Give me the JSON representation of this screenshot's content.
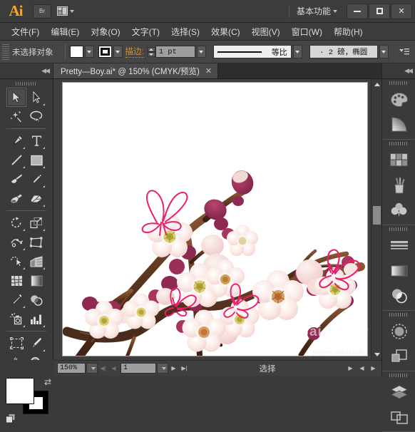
{
  "app": {
    "logo": "Ai",
    "bridge_label": "Br",
    "arrange_label": "arrange-documents",
    "workspace": "基本功能",
    "window_buttons": {
      "minimize": "minimize",
      "maximize": "maximize",
      "close": "✕"
    }
  },
  "menubar": {
    "items": [
      {
        "label": "文件(F)",
        "name": "menu-file"
      },
      {
        "label": "编辑(E)",
        "name": "menu-edit"
      },
      {
        "label": "对象(O)",
        "name": "menu-object"
      },
      {
        "label": "文字(T)",
        "name": "menu-type"
      },
      {
        "label": "选择(S)",
        "name": "menu-select"
      },
      {
        "label": "效果(C)",
        "name": "menu-effect"
      },
      {
        "label": "视图(V)",
        "name": "menu-view"
      },
      {
        "label": "窗口(W)",
        "name": "menu-window"
      },
      {
        "label": "帮助(H)",
        "name": "menu-help"
      }
    ]
  },
  "controlbar": {
    "selection_status": "未选择对象",
    "fill_color": "#ffffff",
    "stroke_color": "#000000",
    "stroke_label": "描边:",
    "stroke_weight": "1 pt",
    "brush_definition": "等比",
    "variable_width_profile": "·  2 磅，椭圆",
    "panel_menu": "panel-menu"
  },
  "document": {
    "tab_title": "Pretty—Boy.ai* @ 150% (CMYK/预览)",
    "close_label": "✕"
  },
  "toolbar": {
    "tools": [
      {
        "name": "selection-tool",
        "label": "选择工具",
        "selected": true,
        "has_flyout": false
      },
      {
        "name": "direct-selection-tool",
        "label": "直接选择工具",
        "selected": false,
        "has_flyout": true
      },
      {
        "name": "magic-wand-tool",
        "label": "魔棒工具",
        "selected": false,
        "has_flyout": false
      },
      {
        "name": "lasso-tool",
        "label": "套索工具",
        "selected": false,
        "has_flyout": false
      },
      {
        "name": "pen-tool",
        "label": "钢笔工具",
        "selected": false,
        "has_flyout": true
      },
      {
        "name": "type-tool",
        "label": "文字工具",
        "selected": false,
        "has_flyout": true
      },
      {
        "name": "line-segment-tool",
        "label": "直线段工具",
        "selected": false,
        "has_flyout": true
      },
      {
        "name": "rectangle-tool",
        "label": "矩形工具",
        "selected": false,
        "has_flyout": true
      },
      {
        "name": "paintbrush-tool",
        "label": "画笔工具",
        "selected": false,
        "has_flyout": false
      },
      {
        "name": "pencil-tool",
        "label": "铅笔工具",
        "selected": false,
        "has_flyout": true
      },
      {
        "name": "blob-brush-tool",
        "label": "斑点画笔工具",
        "selected": false,
        "has_flyout": false
      },
      {
        "name": "eraser-tool",
        "label": "橡皮擦工具",
        "selected": false,
        "has_flyout": true
      },
      {
        "name": "rotate-tool",
        "label": "旋转工具",
        "selected": false,
        "has_flyout": true
      },
      {
        "name": "scale-tool",
        "label": "比例缩放工具",
        "selected": false,
        "has_flyout": true
      },
      {
        "name": "width-tool",
        "label": "宽度工具",
        "selected": false,
        "has_flyout": true
      },
      {
        "name": "free-transform-tool",
        "label": "自由变换工具",
        "selected": false,
        "has_flyout": false
      },
      {
        "name": "shape-builder-tool",
        "label": "形状生成器工具",
        "selected": false,
        "has_flyout": true
      },
      {
        "name": "perspective-grid-tool",
        "label": "透视网格工具",
        "selected": false,
        "has_flyout": true
      },
      {
        "name": "mesh-tool",
        "label": "网格工具",
        "selected": false,
        "has_flyout": false
      },
      {
        "name": "gradient-tool",
        "label": "渐变工具",
        "selected": false,
        "has_flyout": false
      },
      {
        "name": "eyedropper-tool",
        "label": "吸管工具",
        "selected": false,
        "has_flyout": true
      },
      {
        "name": "blend-tool",
        "label": "混合工具",
        "selected": false,
        "has_flyout": false
      },
      {
        "name": "symbol-sprayer-tool",
        "label": "符号喷枪工具",
        "selected": false,
        "has_flyout": true
      },
      {
        "name": "column-graph-tool",
        "label": "柱形图工具",
        "selected": false,
        "has_flyout": true
      },
      {
        "name": "artboard-tool",
        "label": "画板工具",
        "selected": false,
        "has_flyout": false
      },
      {
        "name": "slice-tool",
        "label": "切片工具",
        "selected": false,
        "has_flyout": true
      },
      {
        "name": "hand-tool",
        "label": "抓手工具",
        "selected": false,
        "has_flyout": true
      },
      {
        "name": "zoom-tool",
        "label": "缩放工具",
        "selected": false,
        "has_flyout": false
      }
    ],
    "fill_color": "#ffffff",
    "stroke_color": "#000000",
    "swap_label": "互换填色和描边"
  },
  "right_dock": {
    "groups": [
      {
        "icons": [
          {
            "name": "color-panel-icon",
            "label": "颜色"
          },
          {
            "name": "gradient-panel-icon",
            "label": "渐变"
          }
        ]
      },
      {
        "icons": [
          {
            "name": "swatches-panel-icon",
            "label": "色板"
          },
          {
            "name": "brushes-panel-icon",
            "label": "画笔"
          },
          {
            "name": "symbols-panel-icon",
            "label": "符号"
          }
        ]
      },
      {
        "icons": [
          {
            "name": "stroke-panel-icon",
            "label": "描边"
          },
          {
            "name": "gradient2-panel-icon",
            "label": "渐变"
          },
          {
            "name": "transparency-panel-icon",
            "label": "透明度"
          }
        ]
      },
      {
        "icons": [
          {
            "name": "appearance-panel-icon",
            "label": "外观"
          },
          {
            "name": "graphic-styles-panel-icon",
            "label": "图形样式"
          }
        ]
      },
      {
        "icons": [
          {
            "name": "layers-panel-icon",
            "label": "图层"
          },
          {
            "name": "artboards-panel-icon",
            "label": "画板"
          }
        ]
      }
    ]
  },
  "statusbar": {
    "zoom_level": "150%",
    "page_number": "1",
    "status_text": "选择",
    "first_page": "first-page",
    "prev_page": "previous-page",
    "next_page": "next-page",
    "last_page": "last-page"
  },
  "artwork": {
    "title": "plum-blossom-branch-illustration",
    "colors": {
      "branch_dark": "#4a2c1d",
      "branch_mid": "#6b4026",
      "branch_light": "#8a5633",
      "bud_deep": "#8e2a52",
      "bud_magenta": "#a83560",
      "petal_pale": "#fbeae6",
      "petal_pink": "#f6d8d6",
      "petal_shadow": "#eec4c2",
      "center_olive": "#b5a43a",
      "center_gold": "#cf8f4a",
      "butterfly_pink": "#e8206a"
    }
  },
  "watermark": {
    "text": "Baidu经验",
    "sub": "jingyan.baidu.com"
  }
}
